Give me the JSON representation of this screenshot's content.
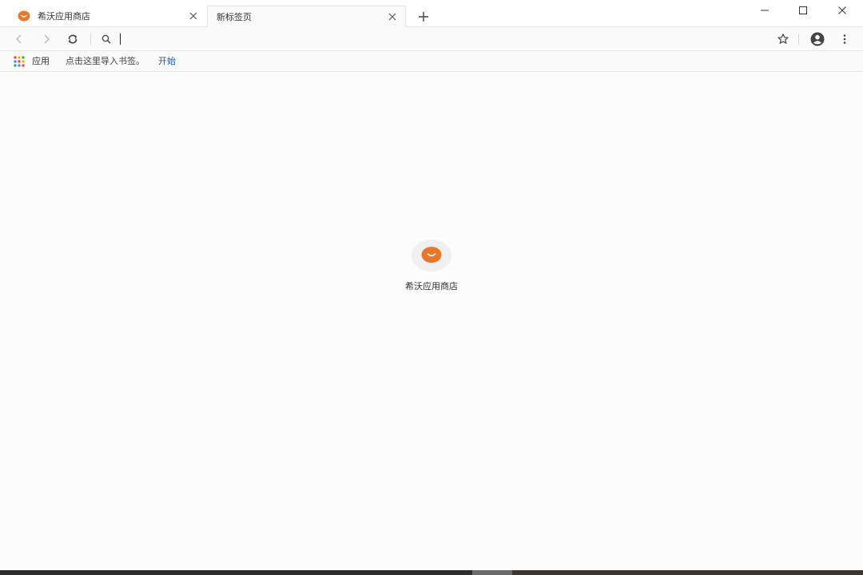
{
  "tabs": [
    {
      "title": "希沃应用商店",
      "active": false,
      "favicon": "seewo-smile-icon"
    },
    {
      "title": "新标签页",
      "active": true
    }
  ],
  "toolbar": {
    "address_value": "",
    "icons": [
      "back-icon",
      "forward-icon",
      "reload-icon",
      "search-icon",
      "star-icon",
      "account-icon",
      "menu-icon"
    ]
  },
  "bookmarks": {
    "apps_label": "应用",
    "hint": "点击这里导入书签。",
    "start_link": "开始"
  },
  "shortcuts": [
    {
      "label": "希沃应用商店",
      "icon": "seewo-smile-icon"
    }
  ],
  "colors": {
    "brand_orange": "#e9772a",
    "link_blue": "#1a56c4",
    "page_bg": "#fcfcfc"
  }
}
